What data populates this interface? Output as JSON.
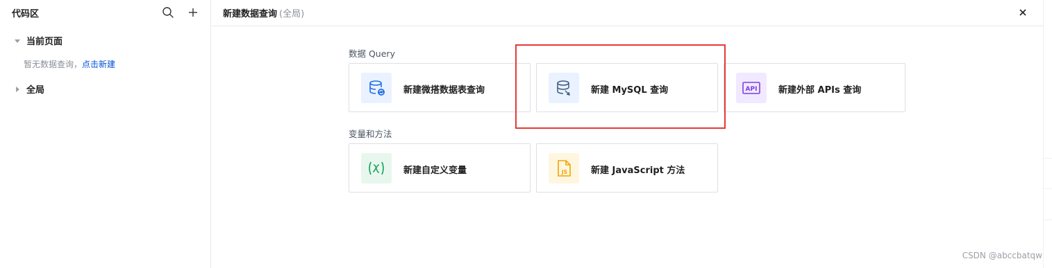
{
  "sidebar": {
    "title": "代码区",
    "tree": [
      {
        "label": "当前页面",
        "expanded": true
      },
      {
        "label": "全局",
        "expanded": false
      }
    ],
    "empty_text": "暂无数据查询，",
    "empty_link": "点击新建"
  },
  "panel": {
    "title": "新建数据查询",
    "scope": "(全局)"
  },
  "sections": [
    {
      "label": "数据 Query",
      "cards": [
        {
          "label": "新建微搭数据表查询",
          "icon": "database-sync-icon"
        },
        {
          "label": "新建 MySQL 查询",
          "icon": "database-mysql-icon"
        },
        {
          "label": "新建外部 APIs 查询",
          "icon": "api-icon"
        }
      ]
    },
    {
      "label": "变量和方法",
      "cards": [
        {
          "label": "新建自定义变量",
          "icon": "variable-x-icon"
        },
        {
          "label": "新建 JavaScript 方法",
          "icon": "javascript-file-icon"
        }
      ]
    }
  ],
  "watermark": "CSDN @abccbatqw",
  "colors": {
    "accent_blue": "#0052d9",
    "highlight_red": "#e53935",
    "icon_blue_bg": "#eaf2ff",
    "icon_purple_bg": "#f1e9ff",
    "icon_green_bg": "#e8f7ee",
    "icon_yellow_bg": "#fff6e0"
  }
}
